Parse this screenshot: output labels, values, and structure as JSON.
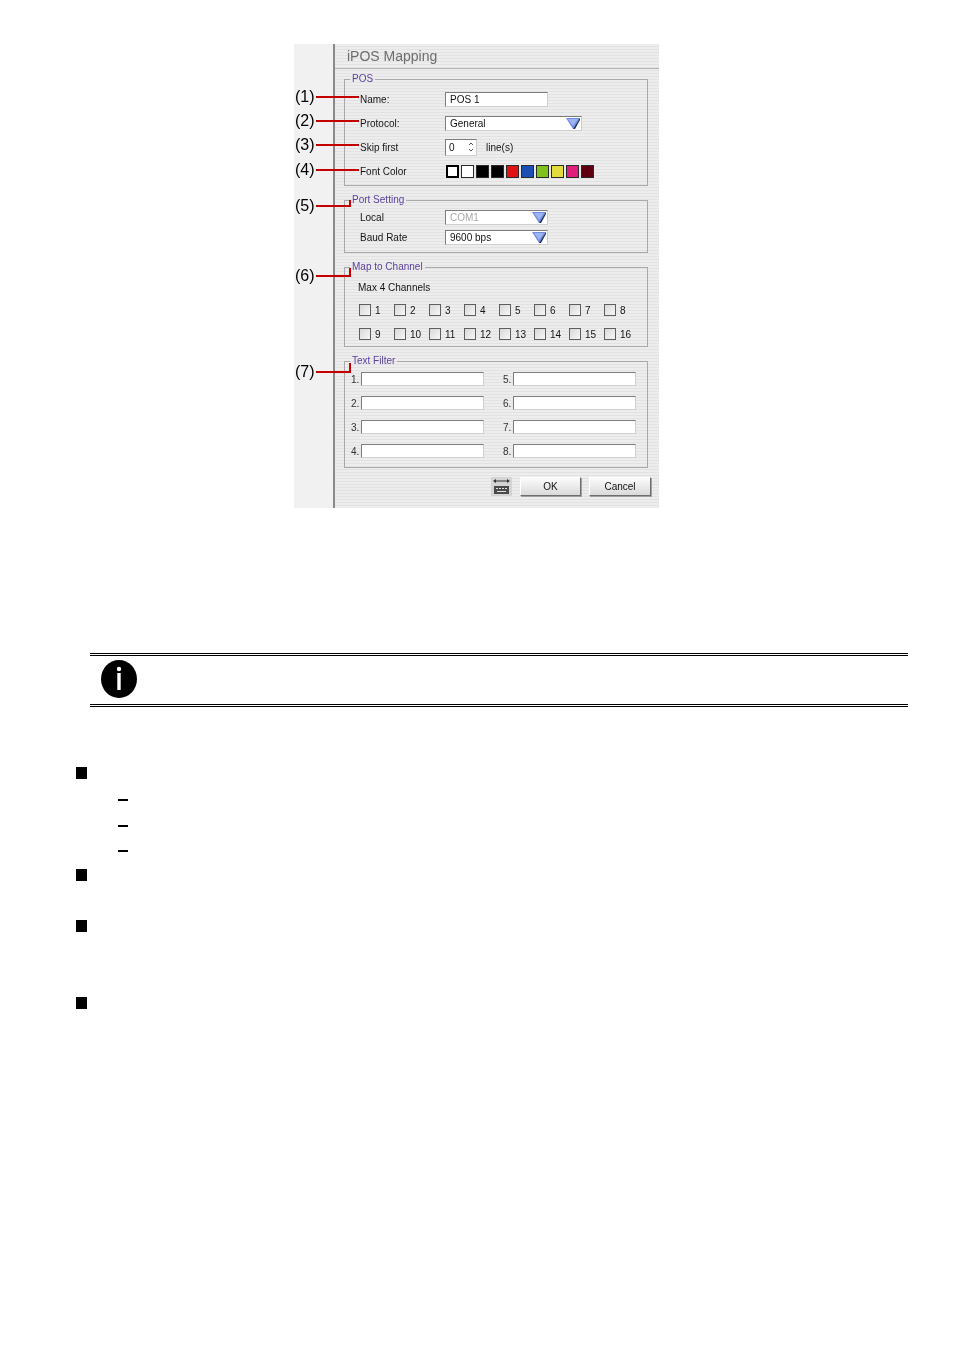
{
  "callouts": [
    "(1)",
    "(2)",
    "(3)",
    "(4)",
    "(5)",
    "(6)",
    "(7)"
  ],
  "dialog": {
    "title": "iPOS Mapping",
    "groups": [
      {
        "kind": "form",
        "legend": "POS",
        "rows": [
          {
            "kind": "text",
            "label": "Name:",
            "value": "POS 1"
          },
          {
            "kind": "dropdown",
            "label": "Protocol:",
            "value": "General",
            "disabled": false
          },
          {
            "kind": "spinner",
            "label": "Skip first",
            "value": "0",
            "unit": "line(s)"
          },
          {
            "kind": "colors",
            "label": "Font Color",
            "swatches": [
              {
                "color": "#ffffff",
                "selected": true
              },
              {
                "color": "#ffffff",
                "selected": false
              },
              {
                "color": "#000000",
                "selected": false
              },
              {
                "color": "#000000",
                "selected": false
              },
              {
                "color": "#e01414",
                "selected": false
              },
              {
                "color": "#1c4fb4",
                "selected": false
              },
              {
                "color": "#7fc21e",
                "selected": false
              },
              {
                "color": "#e2dc3c",
                "selected": false
              },
              {
                "color": "#de1f7c",
                "selected": false
              },
              {
                "color": "#5e0010",
                "selected": false
              }
            ]
          }
        ]
      },
      {
        "kind": "form",
        "legend": "Port Setting",
        "rows": [
          {
            "kind": "dropdown",
            "label": "Local",
            "value": "COM1",
            "disabled": true
          },
          {
            "kind": "dropdown",
            "label": "Baud Rate",
            "value": "9600 bps",
            "disabled": false
          }
        ]
      },
      {
        "kind": "channels",
        "legend": "Map to Channel",
        "note": "Max 4 Channels",
        "channels": [
          {
            "label": "1",
            "checked": false
          },
          {
            "label": "2",
            "checked": false
          },
          {
            "label": "3",
            "checked": false
          },
          {
            "label": "4",
            "checked": false
          },
          {
            "label": "5",
            "checked": false
          },
          {
            "label": "6",
            "checked": false
          },
          {
            "label": "7",
            "checked": false
          },
          {
            "label": "8",
            "checked": false
          },
          {
            "label": "9",
            "checked": false
          },
          {
            "label": "10",
            "checked": false
          },
          {
            "label": "11",
            "checked": false
          },
          {
            "label": "12",
            "checked": false
          },
          {
            "label": "13",
            "checked": false
          },
          {
            "label": "14",
            "checked": false
          },
          {
            "label": "15",
            "checked": false
          },
          {
            "label": "16",
            "checked": false
          }
        ]
      },
      {
        "kind": "filters",
        "legend": "Text Filter",
        "fields": [
          {
            "label": "1."
          },
          {
            "label": "2."
          },
          {
            "label": "3."
          },
          {
            "label": "4."
          },
          {
            "label": "5."
          },
          {
            "label": "6."
          },
          {
            "label": "7."
          },
          {
            "label": "8."
          }
        ]
      }
    ],
    "buttons": [
      {
        "kind": "icon"
      },
      {
        "kind": "text",
        "label": "OK"
      },
      {
        "kind": "text",
        "label": "Cancel"
      }
    ]
  },
  "bullet_list": [
    {
      "kind": "square"
    },
    {
      "kind": "dash"
    },
    {
      "kind": "dash"
    },
    {
      "kind": "dash"
    },
    {
      "kind": "square"
    },
    {
      "kind": "square"
    },
    {
      "kind": "square"
    }
  ]
}
